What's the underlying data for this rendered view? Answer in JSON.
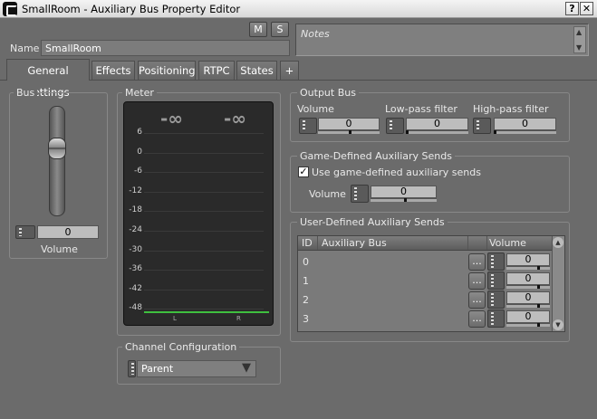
{
  "window": {
    "title": "SmallRoom - Auxiliary Bus Property Editor",
    "help": "?",
    "close": "✕"
  },
  "ms": {
    "m": "M",
    "s": "S"
  },
  "name": {
    "label": "Name",
    "value": "SmallRoom"
  },
  "notes": {
    "label": "Notes"
  },
  "tabs": [
    "General Settings",
    "Effects",
    "Positioning",
    "RTPC",
    "States",
    "+"
  ],
  "bus": {
    "title": "Bus",
    "volume_value": "0",
    "volume_label": "Volume",
    "volume_fraction": 0.5
  },
  "meter": {
    "title": "Meter",
    "left_peak": "-∞",
    "right_peak": "-∞",
    "ticks": [
      "6",
      "0",
      "-6",
      "-12",
      "-18",
      "-24",
      "-30",
      "-36",
      "-42",
      "-48"
    ],
    "left_ch": "L",
    "right_ch": "R"
  },
  "output_bus": {
    "title": "Output Bus",
    "volume": {
      "label": "Volume",
      "value": "0",
      "fraction": 0.5
    },
    "lowpass": {
      "label": "Low-pass filter",
      "value": "0",
      "fraction": 0.0
    },
    "highpass": {
      "label": "High-pass filter",
      "value": "0",
      "fraction": 0.0
    }
  },
  "game_sends": {
    "title": "Game-Defined Auxiliary Sends",
    "checkbox_label": "Use game-defined auxiliary sends",
    "checked": true,
    "volume_label": "Volume",
    "volume_value": "0",
    "volume_fraction": 0.5
  },
  "user_sends": {
    "title": "User-Defined Auxiliary Sends",
    "columns": [
      "ID",
      "Auxiliary Bus",
      "Volume"
    ],
    "browse": "...",
    "rows": [
      {
        "id": "0",
        "bus": "",
        "volume": "0"
      },
      {
        "id": "1",
        "bus": "",
        "volume": "0"
      },
      {
        "id": "2",
        "bus": "",
        "volume": "0"
      },
      {
        "id": "3",
        "bus": "",
        "volume": "0"
      }
    ]
  },
  "channel_config": {
    "title": "Channel Configuration",
    "value": "Parent"
  }
}
